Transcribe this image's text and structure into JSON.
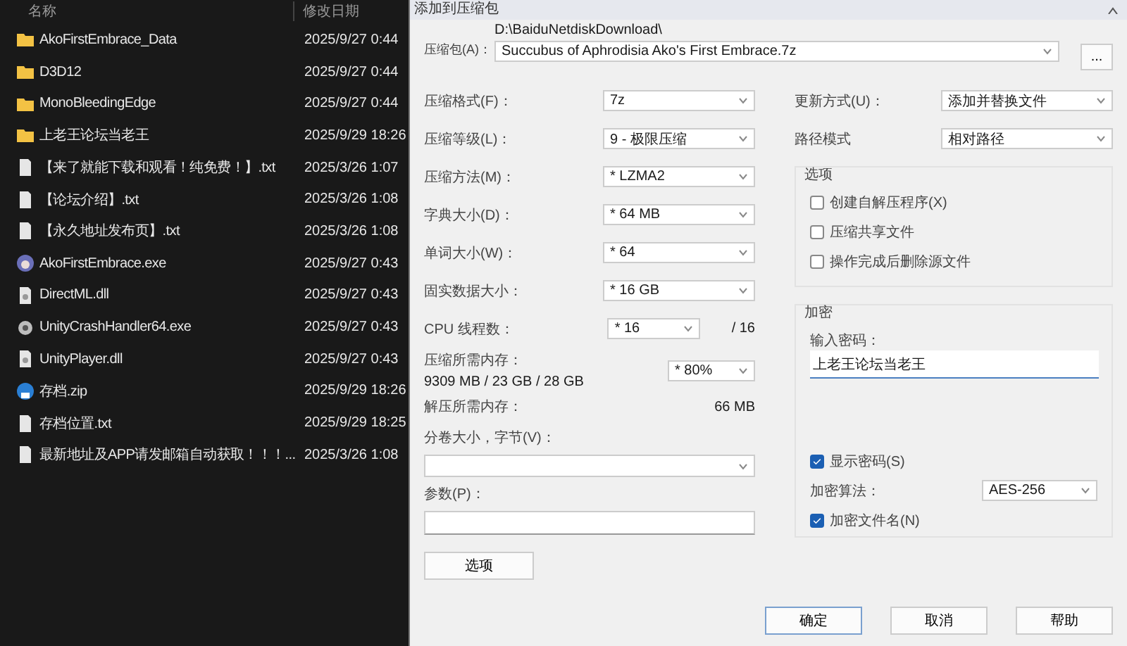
{
  "explorer": {
    "columns": [
      "名称",
      "修改日期"
    ],
    "files": [
      {
        "name": "AkoFirstEmbrace_Data",
        "modified": "2025/9/27 0:44",
        "kind": "folder"
      },
      {
        "name": "D3D12",
        "modified": "2025/9/27 0:44",
        "kind": "folder"
      },
      {
        "name": "MonoBleedingEdge",
        "modified": "2025/9/27 0:44",
        "kind": "folder"
      },
      {
        "name": "上老王论坛当老王",
        "modified": "2025/9/29 18:26",
        "kind": "folder"
      },
      {
        "name": "【来了就能下载和观看！纯免费！】.txt",
        "modified": "2025/3/26 1:07",
        "kind": "text"
      },
      {
        "name": "【论坛介绍】.txt",
        "modified": "2025/3/26 1:08",
        "kind": "text"
      },
      {
        "name": "【永久地址发布页】.txt",
        "modified": "2025/3/26 1:08",
        "kind": "text"
      },
      {
        "name": "AkoFirstEmbrace.exe",
        "modified": "2025/9/27 0:43",
        "kind": "app"
      },
      {
        "name": "DirectML.dll",
        "modified": "2025/9/27 0:43",
        "kind": "dll"
      },
      {
        "name": "UnityCrashHandler64.exe",
        "modified": "2025/9/27 0:43",
        "kind": "gear"
      },
      {
        "name": "UnityPlayer.dll",
        "modified": "2025/9/27 0:43",
        "kind": "dll"
      },
      {
        "name": "存档.zip",
        "modified": "2025/9/29 18:26",
        "kind": "zip"
      },
      {
        "name": "存档位置.txt",
        "modified": "2025/9/29 18:25",
        "kind": "text"
      },
      {
        "name": "最新地址及APP请发邮箱自动获取！！！...",
        "modified": "2025/3/26 1:08",
        "kind": "text"
      }
    ]
  },
  "dialog": {
    "title": "添加到压缩包",
    "archive": {
      "label": "压缩包(A)：",
      "folder": "D:\\BaiduNetdiskDownload\\",
      "value": "Succubus of Aphrodisia Ako's First Embrace.7z",
      "browse": "..."
    },
    "left_rows": [
      {
        "kind": "combo",
        "label": "压缩格式(F)：",
        "value": "7z"
      },
      {
        "kind": "combo",
        "label": "压缩等级(L)：",
        "value": "9 - 极限压缩"
      },
      {
        "kind": "combo",
        "label": "压缩方法(M)：",
        "value": "* LZMA2"
      },
      {
        "kind": "combo",
        "label": "字典大小(D)：",
        "value": "* 64 MB"
      },
      {
        "kind": "combo",
        "label": "单词大小(W)：",
        "value": "* 64"
      },
      {
        "kind": "combo",
        "label": "固实数据大小：",
        "value": "* 16 GB"
      },
      {
        "kind": "threads",
        "label": "CPU 线程数：",
        "value": "* 16",
        "suffix": "/ 16"
      },
      {
        "kind": "memory",
        "label": "压缩所需内存：",
        "detail": "9309 MB / 23 GB / 28 GB",
        "value": "* 80%"
      },
      {
        "kind": "info",
        "label": "解压所需内存：",
        "value": "66 MB"
      },
      {
        "kind": "volume",
        "label": "分卷大小，字节(V)："
      },
      {
        "kind": "params",
        "label": "参数(P)："
      }
    ],
    "right_rows": [
      {
        "label": "更新方式(U)：",
        "value": "添加并替换文件"
      },
      {
        "label": "路径模式",
        "value": "相对路径"
      }
    ],
    "options": {
      "title": "选项",
      "items": [
        {
          "label": "创建自解压程序(X)",
          "checked": false
        },
        {
          "label": "压缩共享文件",
          "checked": false
        },
        {
          "label": "操作完成后删除源文件",
          "checked": false
        }
      ]
    },
    "encryption": {
      "title": "加密",
      "password_label": "输入密码：",
      "password": "上老王论坛当老王",
      "show_password": {
        "label": "显示密码(S)",
        "checked": true
      },
      "method_label": "加密算法：",
      "method": "AES-256",
      "encrypt_names": {
        "label": "加密文件名(N)",
        "checked": true
      }
    },
    "options_button": "选项",
    "buttons": [
      {
        "label": "确定",
        "default": true
      },
      {
        "label": "取消",
        "default": false
      },
      {
        "label": "帮助",
        "default": false
      }
    ]
  }
}
